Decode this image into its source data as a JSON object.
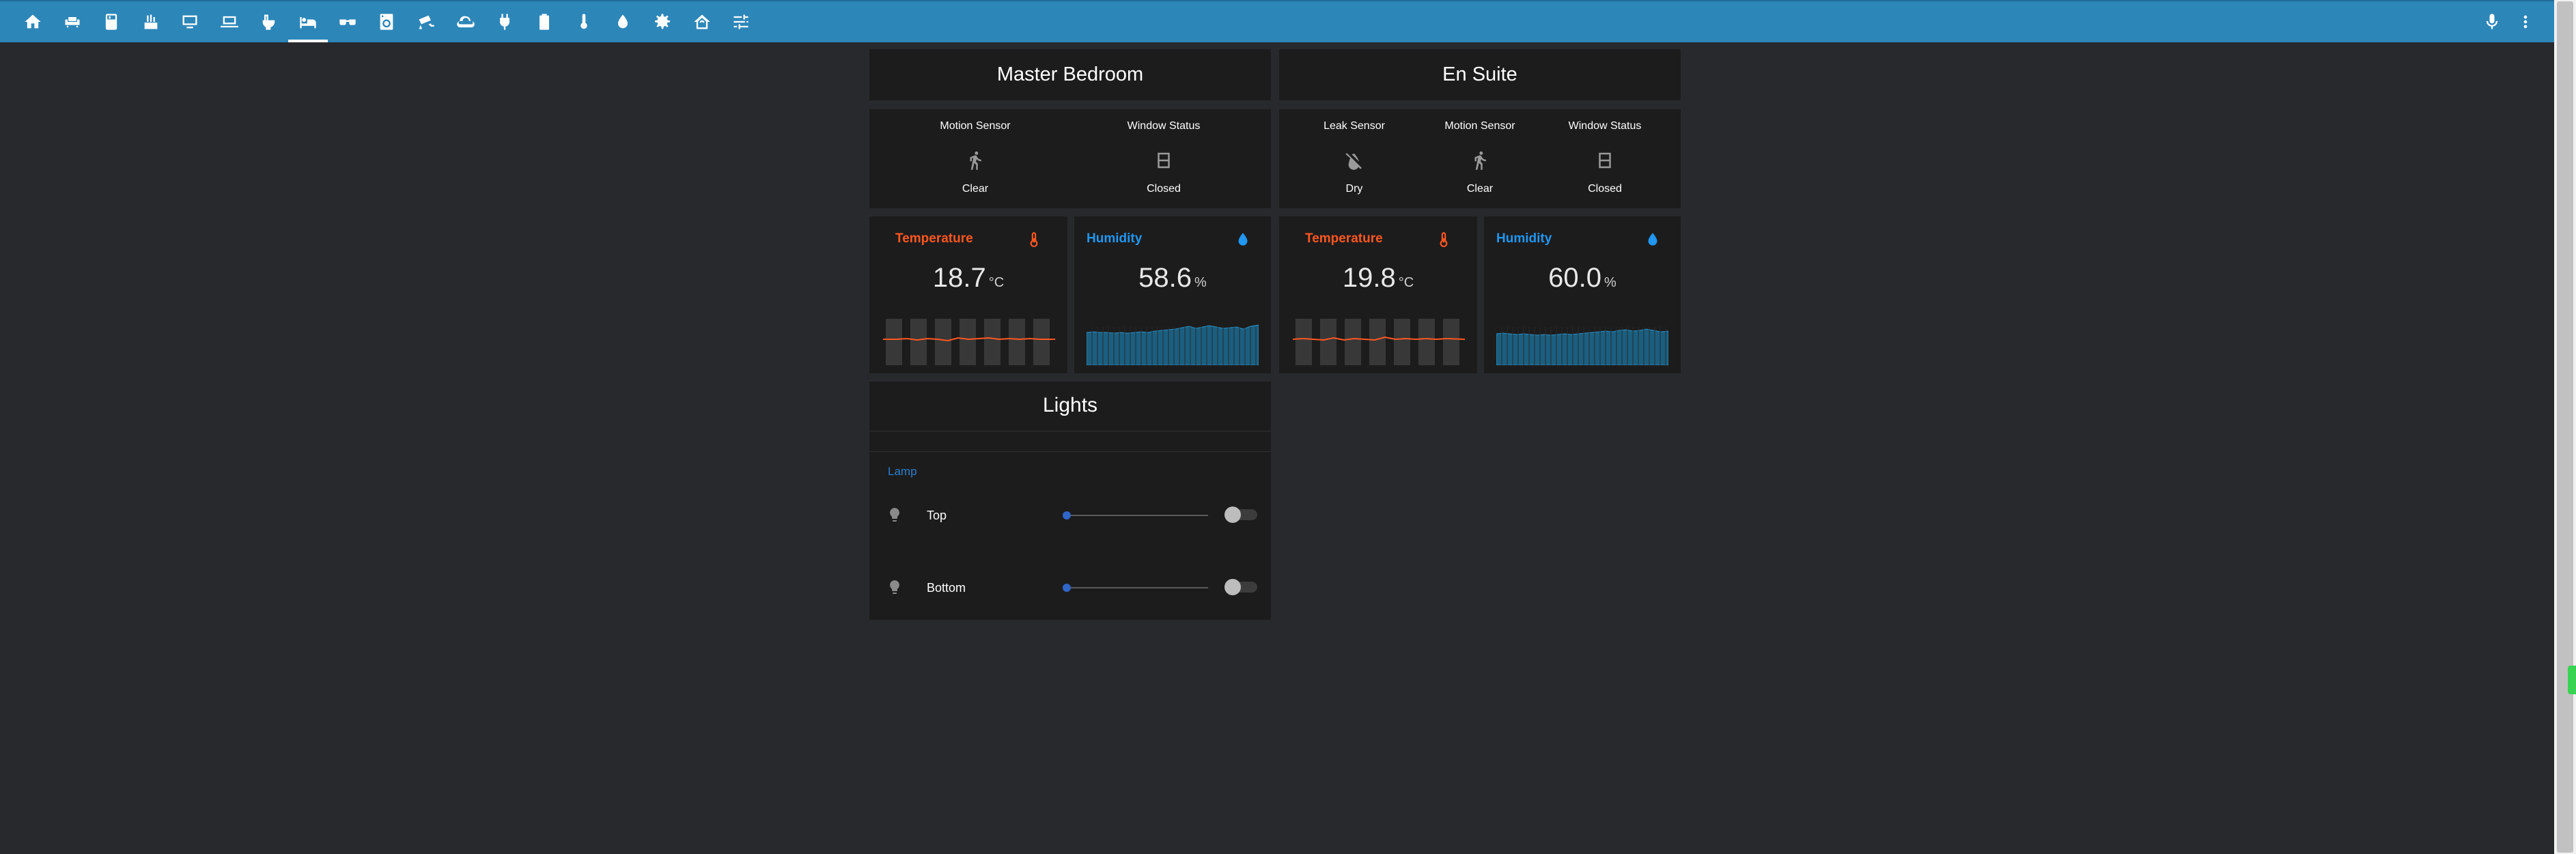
{
  "toolbar": {
    "tabs": [
      {
        "icon": "home-icon"
      },
      {
        "icon": "sofa-icon"
      },
      {
        "icon": "fridge-icon"
      },
      {
        "icon": "kitchen-icon"
      },
      {
        "icon": "monitor-icon"
      },
      {
        "icon": "laptop-icon"
      },
      {
        "icon": "toilet-icon"
      },
      {
        "icon": "bed-icon",
        "active": true
      },
      {
        "icon": "glasses-icon"
      },
      {
        "icon": "washing-machine-icon"
      },
      {
        "icon": "cctv-icon"
      },
      {
        "icon": "weather-icon"
      },
      {
        "icon": "power-plug-icon"
      },
      {
        "icon": "battery-icon"
      },
      {
        "icon": "thermometer-icon"
      },
      {
        "icon": "water-icon"
      },
      {
        "icon": "settings-icon"
      },
      {
        "icon": "home-automation-icon"
      },
      {
        "icon": "tune-icon"
      }
    ],
    "right_icons": [
      "microphone-icon",
      "more-vert-icon"
    ]
  },
  "master_bedroom": {
    "title": "Master Bedroom",
    "motion": {
      "name": "Motion Sensor",
      "state": "Clear",
      "icon": "walk-icon"
    },
    "window": {
      "name": "Window Status",
      "state": "Closed",
      "icon": "window-closed-icon"
    },
    "temperature": {
      "name": "Temperature",
      "value": "18.7",
      "unit": "°C",
      "color": "#ff5722"
    },
    "humidity": {
      "name": "Humidity",
      "value": "58.6",
      "unit": "%",
      "color": "#2196f3"
    }
  },
  "en_suite": {
    "title": "En Suite",
    "leak": {
      "name": "Leak Sensor",
      "state": "Dry",
      "icon": "water-off-icon"
    },
    "motion": {
      "name": "Motion Sensor",
      "state": "Clear",
      "icon": "walk-icon"
    },
    "window": {
      "name": "Window Status",
      "state": "Closed",
      "icon": "window-closed-icon"
    },
    "temperature": {
      "name": "Temperature",
      "value": "19.8",
      "unit": "°C",
      "color": "#ff5722"
    },
    "humidity": {
      "name": "Humidity",
      "value": "60.0",
      "unit": "%",
      "color": "#2196f3"
    }
  },
  "lights": {
    "title": "Lights",
    "group_label": "Lamp",
    "items": [
      {
        "name": "Top",
        "brightness": 0,
        "on": false,
        "icon": "lightbulb-icon"
      },
      {
        "name": "Bottom",
        "brightness": 0,
        "on": false,
        "icon": "lightbulb-icon"
      }
    ]
  },
  "colors": {
    "toolbar": "#2d86b8",
    "card": "#1c1c1c",
    "background": "#28292c",
    "temperature": "#ff5722",
    "humidity": "#2196f3"
  }
}
